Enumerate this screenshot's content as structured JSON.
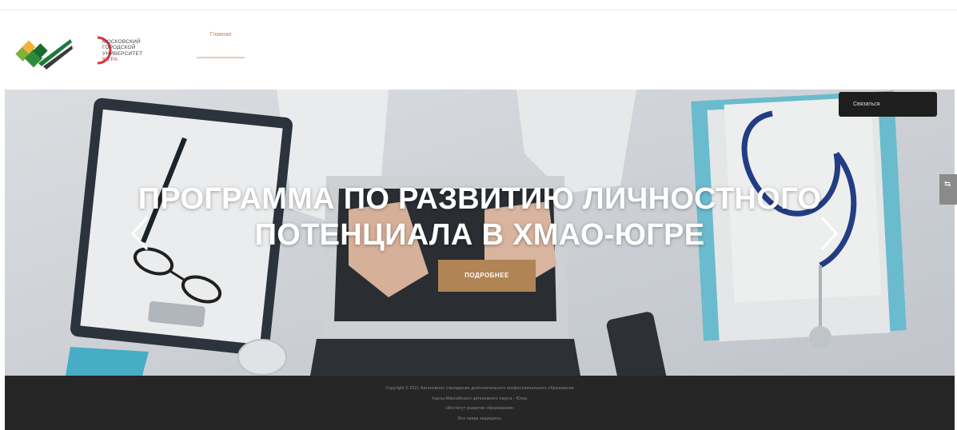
{
  "header": {
    "logo_left_alt": "",
    "logo_right_lines": [
      "МОСКОВСКИЙ",
      "ГОРОДСКОЙ",
      "УНИВЕРСИТЕТ",
      "ЮГРА"
    ],
    "nav": [
      {
        "label": "Главная"
      }
    ]
  },
  "hero": {
    "title_line1": "ПРОГРАММА ПО РАЗВИТИЮ ЛИЧНОСТНОГО",
    "title_line2": "ПОТЕНЦИАЛА В ХМАО-ЮГРЕ",
    "button_label": "ПОДРОБНЕЕ",
    "tab_label": "Связаться",
    "prev_icon": "chevron-left-icon",
    "next_icon": "chevron-right-icon",
    "side_icon": "share-icon"
  },
  "footer": {
    "lines": [
      "Copyright © 2021 Автономное учреждение дополнительного профессионального образования",
      "Ханты-Мансийского автономного округа - Югры",
      "«Институт развития образования»",
      "Все права защищены"
    ]
  },
  "colors": {
    "accent": "#b08455",
    "footer_bg": "#262626",
    "nav_active": "#b88b66"
  }
}
